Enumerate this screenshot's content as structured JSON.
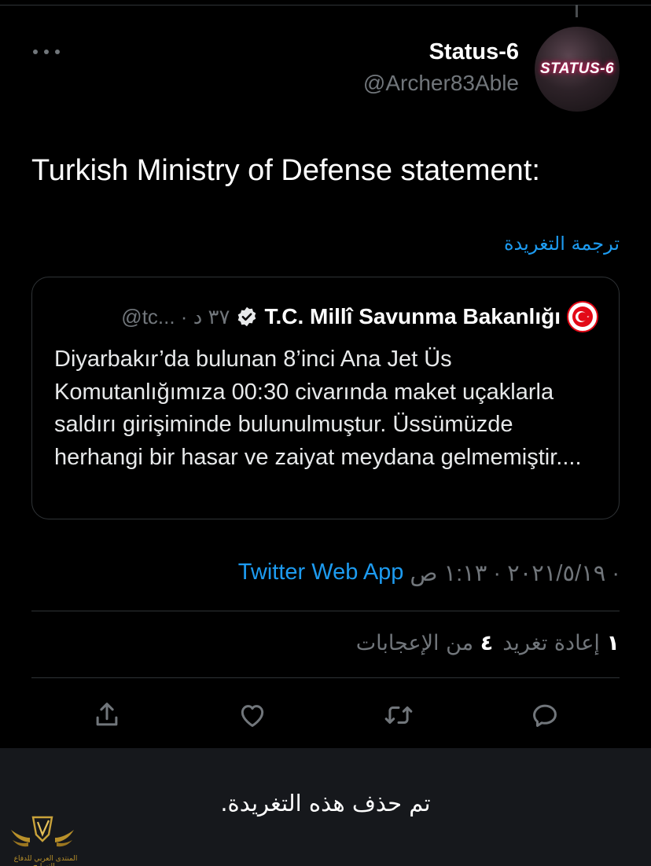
{
  "tweet": {
    "author_name": "Status-6",
    "author_handle": "@Archer83Able",
    "avatar_text": "STATUS-6",
    "text": "Turkish Ministry of Defense statement:",
    "translate_label": "ترجمة التغريدة"
  },
  "quote": {
    "name": "T.C. Millî Savunma Bakanlığı",
    "handle_time": "@tc... · ٣٧ د",
    "body": "Diyarbakır’da bulunan 8’inci Ana Jet Üs Komutanlığımıza 00:30 civarında maket uçaklarla saldırı girişiminde bulunulmuştur. Üssümüzde herhangi bir hasar ve zaiyat meydana gelmemiştir...."
  },
  "meta": {
    "date_time": "٢٠٢١/٥/١٩ · ١:١٣ ص ·",
    "app": "Twitter Web App"
  },
  "stats": {
    "retweet_count": "١",
    "retweet_label": "إعادة تغريد",
    "like_count": "٤",
    "like_label": "من الإعجابات"
  },
  "actions": {
    "reply_icon": "reply-icon",
    "retweet_icon": "retweet-icon",
    "like_icon": "heart-icon",
    "share_icon": "share-icon"
  },
  "notice": {
    "deleted_text": "تم حذف هذه التغريدة."
  },
  "watermark": {
    "text": "المنتدى العربي للدفاع والتسليح"
  },
  "colors": {
    "background": "#000000",
    "link": "#1d9bf0",
    "muted": "#71767b",
    "panel": "#16181c"
  }
}
